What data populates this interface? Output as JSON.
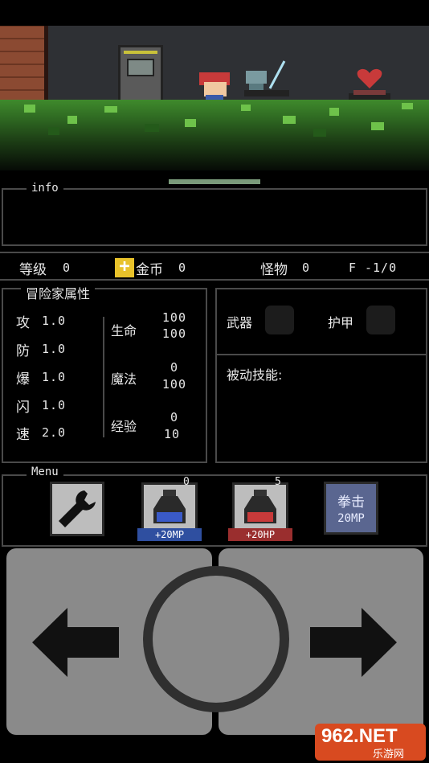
{
  "info": {
    "title": "info"
  },
  "stats": {
    "level_label": "等级",
    "level_value": "0",
    "gold_label": "金币",
    "gold_value": "0",
    "monster_label": "怪物",
    "monster_value": "0",
    "floor_label": "F",
    "floor_value": "-1/0"
  },
  "adventurer": {
    "title": "冒险家属性",
    "attrs": [
      {
        "label": "攻",
        "value": "1.0"
      },
      {
        "label": "防",
        "value": "1.0"
      },
      {
        "label": "爆",
        "value": "1.0"
      },
      {
        "label": "闪",
        "value": "1.0"
      },
      {
        "label": "速",
        "value": "2.0"
      }
    ],
    "hp": {
      "label": "生命",
      "current": "100",
      "max": "100"
    },
    "mp": {
      "label": "魔法",
      "current": "0",
      "max": "100"
    },
    "exp": {
      "label": "经验",
      "current": "0",
      "max": "10"
    }
  },
  "equipment": {
    "weapon_label": "武器",
    "armor_label": "护甲",
    "passive_label": "被动技能:"
  },
  "menu": {
    "title": "Menu",
    "mp_potion": {
      "count": "0",
      "label": "+20MP"
    },
    "hp_potion": {
      "count": "5",
      "label": "+20HP"
    },
    "skill": {
      "name": "拳击",
      "cost": "20MP"
    },
    "icons": [
      "wrench-icon",
      "blue-potion-icon",
      "red-potion-icon",
      "left-arrow-icon",
      "right-arrow-icon"
    ]
  },
  "watermark": {
    "text": "962.NET",
    "subtext": "乐游网"
  },
  "colors": {
    "mp_tag": "#2f4fa0",
    "hp_tag": "#9a2e2e",
    "skill": "#5a6690",
    "gold_icon": "#e8c22a"
  }
}
